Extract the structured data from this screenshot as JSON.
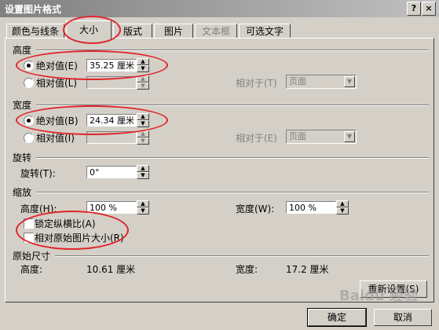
{
  "window": {
    "title": "设置图片格式",
    "help_label": "?",
    "close_label": "×"
  },
  "tabs": [
    {
      "label": "颜色与线条"
    },
    {
      "label": "大小"
    },
    {
      "label": "版式"
    },
    {
      "label": "图片"
    },
    {
      "label": "文本框"
    },
    {
      "label": "可选文字"
    }
  ],
  "height": {
    "section": "高度",
    "absolute_label": "绝对值(E)",
    "absolute_value": "35.25 厘米",
    "relative_label": "相对值(L)",
    "relative_to_label": "相对于(T)",
    "relative_to_value": "页面"
  },
  "width": {
    "section": "宽度",
    "absolute_label": "绝对值(B)",
    "absolute_value": "24.34 厘米",
    "relative_label": "相对值(I)",
    "relative_to_label": "相对于(E)",
    "relative_to_value": "页面"
  },
  "rotation": {
    "section": "旋转",
    "label": "旋转(T):",
    "value": "0°"
  },
  "scale": {
    "section": "缩放",
    "height_label": "高度(H):",
    "height_value": "100 %",
    "width_label": "宽度(W):",
    "width_value": "100 %",
    "lock_aspect_label": "锁定纵横比(A)",
    "relative_original_label": "相对原始图片大小(R)"
  },
  "original": {
    "section": "原始尺寸",
    "height_label": "高度:",
    "height_value": "10.61 厘米",
    "width_label": "宽度:",
    "width_value": "17.2 厘米"
  },
  "buttons": {
    "reset": "重新设置(S)",
    "ok": "确定",
    "cancel": "取消"
  },
  "watermark": "Baidu 经验",
  "colors": {
    "annotation": "#e0242b",
    "dialog_face": "#d4d0c8"
  }
}
